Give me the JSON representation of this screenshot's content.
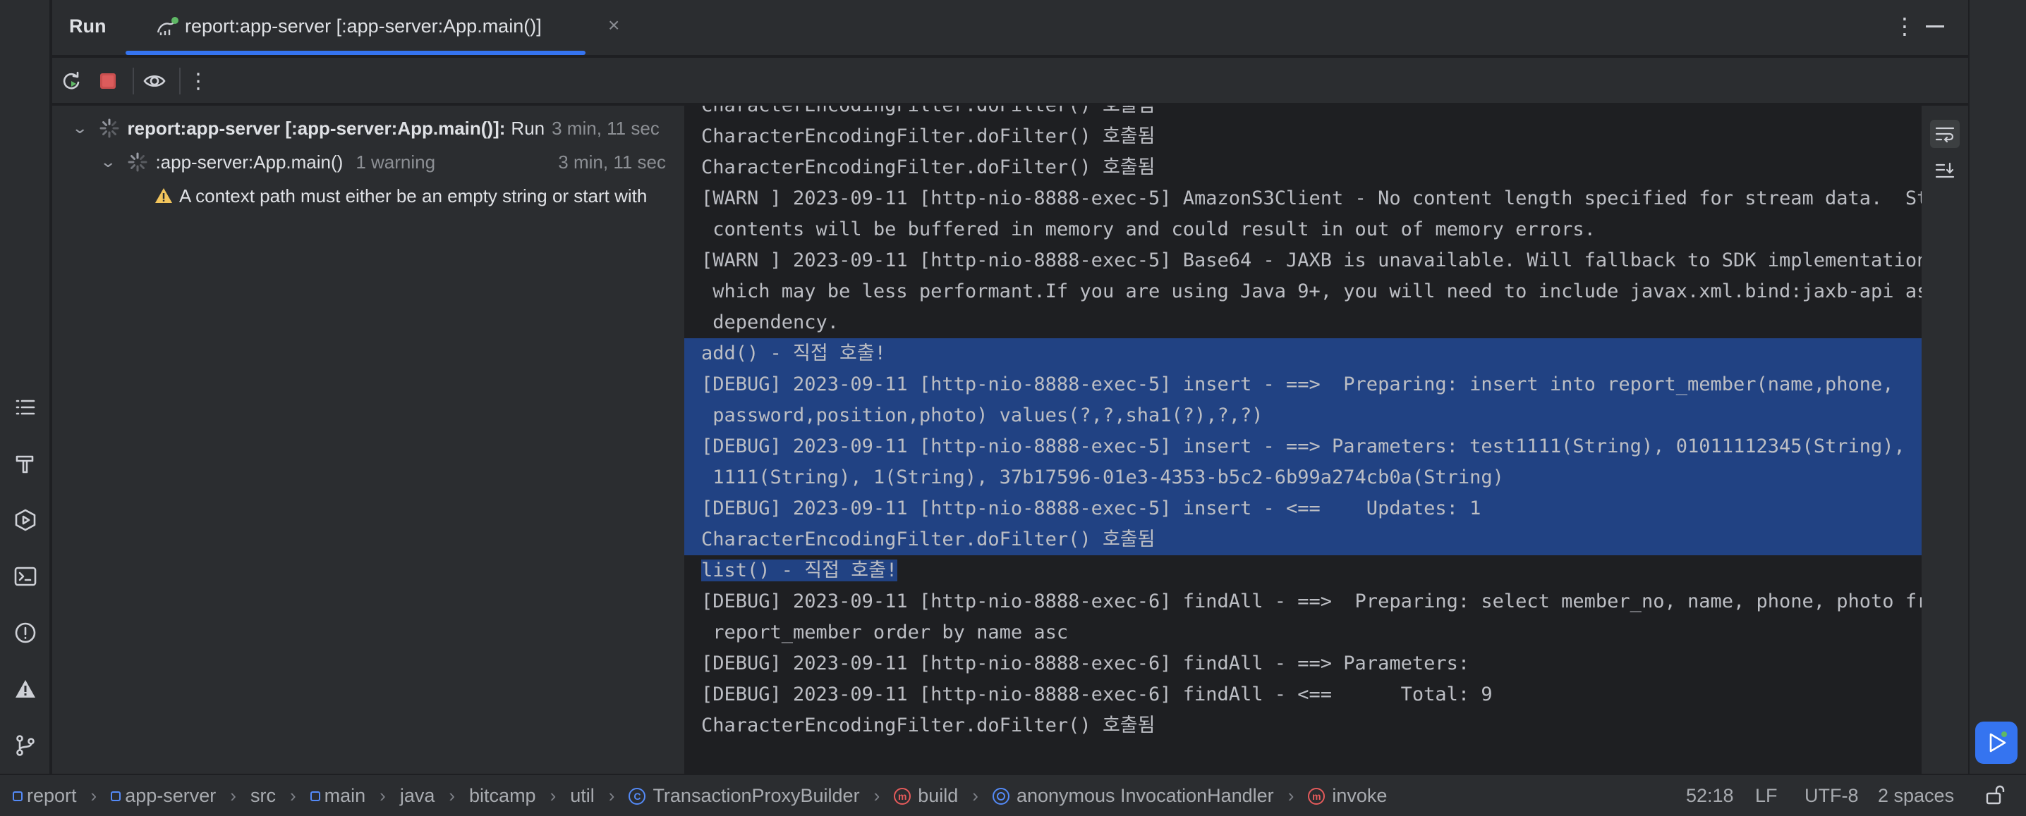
{
  "header": {
    "run_label": "Run",
    "tab_title": "report:app-server [:app-server:App.main()]",
    "tab_close": "×",
    "more": "⋮"
  },
  "tree": {
    "root": {
      "name": "report:app-server [:app-server:App.main()]:",
      "suffix": "Run",
      "time": "3 min, 11 sec"
    },
    "child": {
      "name": ":app-server:App.main()",
      "warning_count": "1 warning",
      "time": "3 min, 11 sec"
    },
    "warning": {
      "text": "A context path must either be an empty string or start with"
    }
  },
  "console": {
    "lines": [
      "CharacterEncodingFilter.doFilter() 호출됨",
      "CharacterEncodingFilter.doFilter() 호출됨",
      "CharacterEncodingFilter.doFilter() 호출됨",
      "[WARN ] 2023-09-11 [http-nio-8888-exec-5] AmazonS3Client - No content length specified for stream data.  Stream",
      " contents will be buffered in memory and could result in out of memory errors.",
      "[WARN ] 2023-09-11 [http-nio-8888-exec-5] Base64 - JAXB is unavailable. Will fallback to SDK implementation",
      " which may be less performant.If you are using Java 9+, you will need to include javax.xml.bind:jaxb-api as a",
      " dependency.",
      "add() - 직접 호출!",
      "[DEBUG] 2023-09-11 [http-nio-8888-exec-5] insert - ==>  Preparing: insert into report_member(name,phone,",
      " password,position,photo) values(?,?,sha1(?),?,?)",
      "[DEBUG] 2023-09-11 [http-nio-8888-exec-5] insert - ==> Parameters: test1111(String), 01011112345(String),",
      " 1111(String), 1(String), 37b17596-01e3-4353-b5c2-6b99a274cb0a(String)",
      "[DEBUG] 2023-09-11 [http-nio-8888-exec-5] insert - <==    Updates: 1",
      "CharacterEncodingFilter.doFilter() 호출됨",
      "list() - 직접 호출!",
      "[DEBUG] 2023-09-11 [http-nio-8888-exec-6] findAll - ==>  Preparing: select member_no, name, phone, photo from",
      " report_member order by name asc",
      "[DEBUG] 2023-09-11 [http-nio-8888-exec-6] findAll - ==> Parameters: ",
      "[DEBUG] 2023-09-11 [http-nio-8888-exec-6] findAll - <==      Total: 9",
      "CharacterEncodingFilter.doFilter() 호출됨"
    ],
    "selected_full_lines": [
      8,
      9,
      10,
      11,
      12,
      13,
      14
    ],
    "selected_partial_line": 15,
    "selection_color": "#214283"
  },
  "statusbar": {
    "breadcrumbs": [
      {
        "label": "report",
        "kind": "module"
      },
      {
        "label": "app-server",
        "kind": "module"
      },
      {
        "label": "src",
        "kind": "folder"
      },
      {
        "label": "main",
        "kind": "module"
      },
      {
        "label": "java",
        "kind": "folder"
      },
      {
        "label": "bitcamp",
        "kind": "folder"
      },
      {
        "label": "util",
        "kind": "folder"
      },
      {
        "label": "TransactionProxyBuilder",
        "kind": "class"
      },
      {
        "label": "build",
        "kind": "method"
      },
      {
        "label": "anonymous InvocationHandler",
        "kind": "anonymous"
      },
      {
        "label": "invoke",
        "kind": "method"
      }
    ],
    "position": "52:18",
    "line_sep": "LF",
    "encoding": "UTF-8",
    "indent": "2 spaces"
  },
  "colors": {
    "accent": "#3574f0",
    "warning": "#f2c55c",
    "stop": "#e55b5b",
    "rerun": "#5fb865"
  }
}
